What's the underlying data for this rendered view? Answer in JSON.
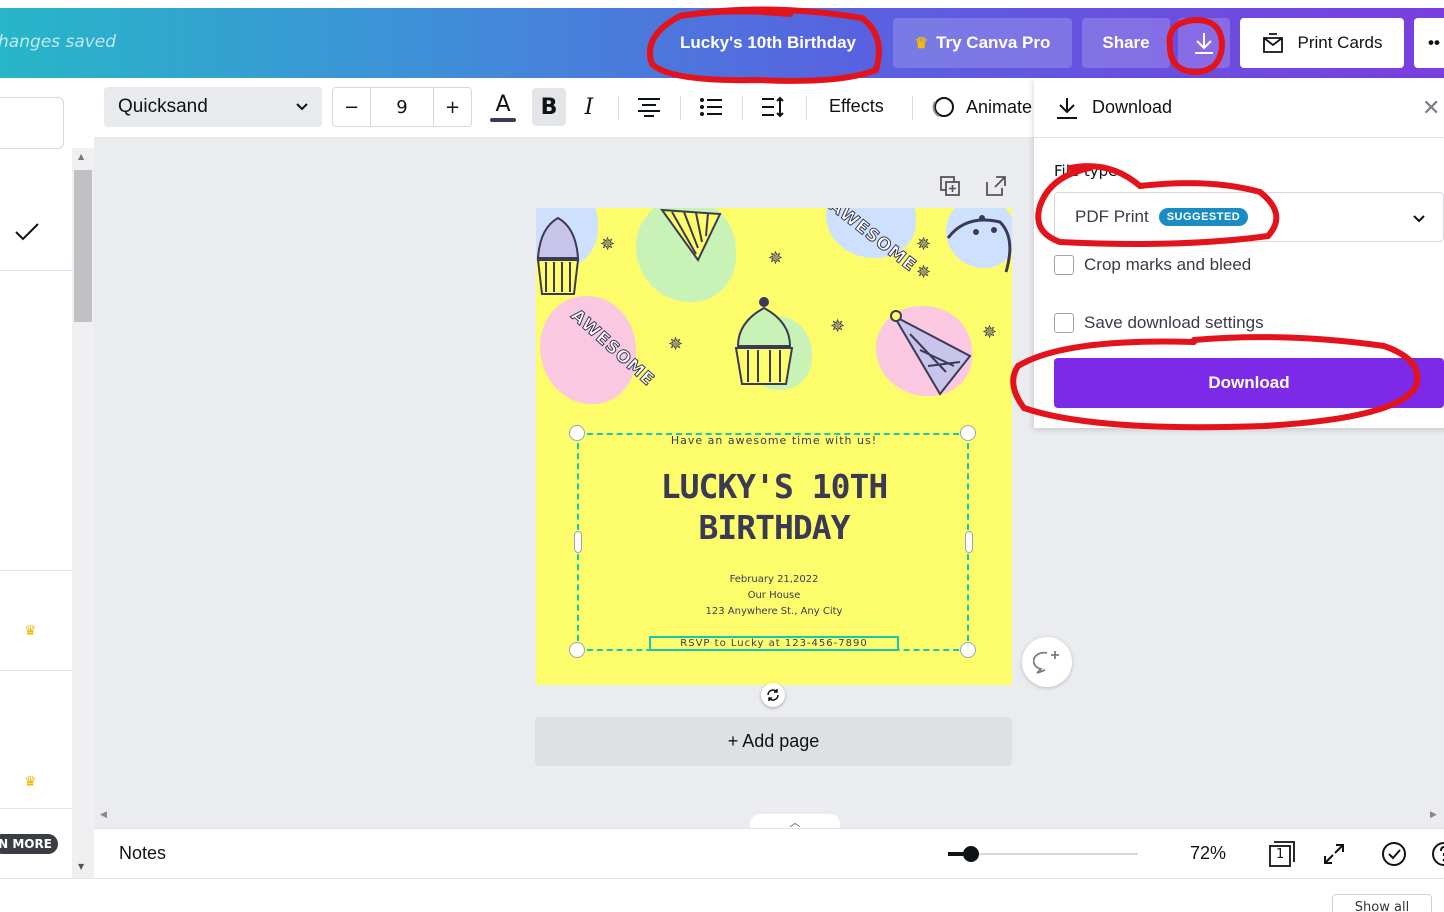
{
  "header": {
    "saved_status": "hanges saved",
    "design_title": "Lucky's 10th Birthday",
    "try_pro_label": "Try Canva Pro",
    "share_label": "Share",
    "print_label": "Print Cards",
    "more_label": "••"
  },
  "left_panel": {
    "more_label": "N MORE"
  },
  "toolbar": {
    "font_name": "Quicksand",
    "font_size": "9",
    "decrease_label": "−",
    "increase_label": "+",
    "text_color_glyph": "A",
    "bold_glyph": "B",
    "italic_glyph": "I",
    "effects_label": "Effects",
    "animate_label": "Animate"
  },
  "card": {
    "tagline": "Have an awesome time with us!",
    "headline_line1": "LUCKY'S 10TH",
    "headline_line2": "BIRTHDAY",
    "date": "February 21,2022",
    "venue": "Our House",
    "address": "123 Anywhere St., Any City",
    "rsvp": "RSVP to Lucky at 123-456-7890",
    "sticker_text": "AWESOME"
  },
  "canvas": {
    "add_page_label": "+ Add page"
  },
  "download_panel": {
    "title": "Download",
    "file_type_label": "File type",
    "file_type_value": "PDF Print",
    "suggested_badge": "SUGGESTED",
    "crop_marks_label": "Crop marks and bleed",
    "crop_marks_checked": false,
    "save_settings_label": "Save download settings",
    "save_settings_checked": false,
    "download_button_label": "Download"
  },
  "bottom_bar": {
    "notes_label": "Notes",
    "zoom_value": "72%",
    "zoom_fraction": 0.12,
    "page_count": "1",
    "show_all_label": "Show all"
  },
  "colors": {
    "accent_purple": "#7d2ae8",
    "card_yellow": "#fdfd6c",
    "selection_teal": "#14c8b8",
    "annotation_red": "#e3131b",
    "suggested_blue": "#1a8cc4"
  }
}
